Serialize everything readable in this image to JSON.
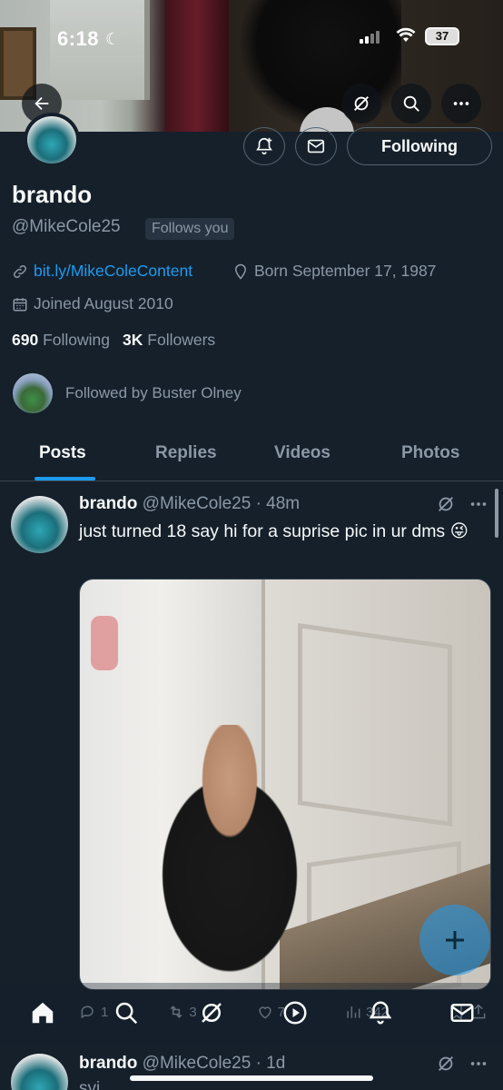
{
  "status_bar": {
    "time": "6:18",
    "battery": "37"
  },
  "profile": {
    "display_name": "brando",
    "handle": "@MikeCole25",
    "follows_you": "Follows you",
    "link": "bit.ly/MikeColeContent",
    "born": "Born September 17, 1987",
    "joined": "Joined August 2010",
    "following_count": "690",
    "following_label": "Following",
    "followers_count": "3K",
    "followers_label": "Followers",
    "followed_by": "Followed by Buster Olney",
    "follow_button": "Following"
  },
  "tabs": [
    "Posts",
    "Replies",
    "Videos",
    "Photos"
  ],
  "active_tab": "Posts",
  "post": {
    "name": "brando",
    "handle_time": "@MikeCole25 · 48m",
    "text": "just turned 18 say hi for a suprise pic in ur dms 😜",
    "replies": "1",
    "reposts": "3",
    "likes": "7",
    "views": "342"
  },
  "post2": {
    "name": "brando",
    "handle_time": "@MikeCole25 · 1d",
    "text": "syi"
  },
  "colors": {
    "background": "#15202b",
    "accent": "#1d9bf0",
    "muted": "#8b98a5"
  },
  "icons": [
    "back-icon",
    "grok-icon",
    "search-icon",
    "more-icon",
    "notification-plus-icon",
    "mail-icon",
    "link-icon",
    "location-icon",
    "calendar-icon",
    "reply-icon",
    "repost-icon",
    "like-icon",
    "views-icon",
    "bookmark-icon",
    "share-icon",
    "home-icon",
    "explore-icon",
    "video-icon",
    "bell-icon",
    "messages-icon",
    "compose-icon"
  ]
}
